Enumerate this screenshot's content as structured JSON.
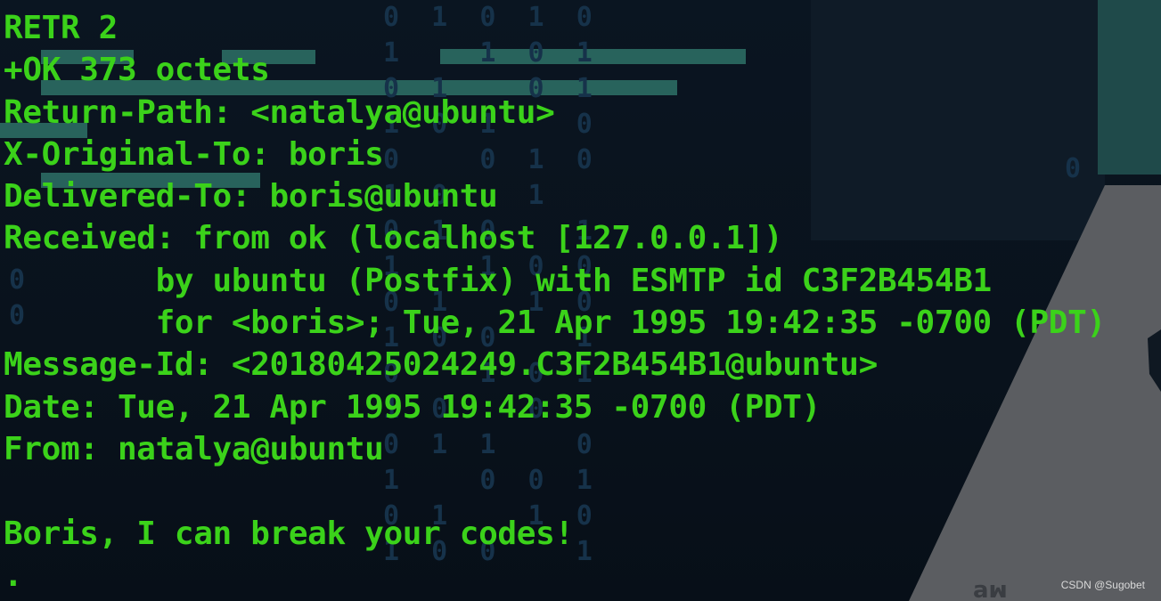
{
  "terminal": {
    "lines": [
      "RETR 2",
      "+OK 373 octets",
      "Return-Path: <natalya@ubuntu>",
      "X-Original-To: boris",
      "Delivered-To: boris@ubuntu",
      "Received: from ok (localhost [127.0.0.1])",
      "        by ubuntu (Postfix) with ESMTP id C3F2B454B1",
      "        for <boris>; Tue, 21 Apr 1995 19:42:35 -0700 (PDT)",
      "Message-Id: <20180425024249.C3F2B454B1@ubuntu>",
      "Date: Tue, 21 Apr 1995 19:42:35 -0700 (PDT)",
      "From: natalya@ubuntu",
      "",
      "Boris, I can break your codes!",
      "."
    ]
  },
  "watermark": {
    "credit": "CSDN @Sugobet"
  },
  "colors": {
    "terminal_text": "#3bd21a",
    "background": "#0b1420",
    "accent_teal": "#2b6b63"
  }
}
